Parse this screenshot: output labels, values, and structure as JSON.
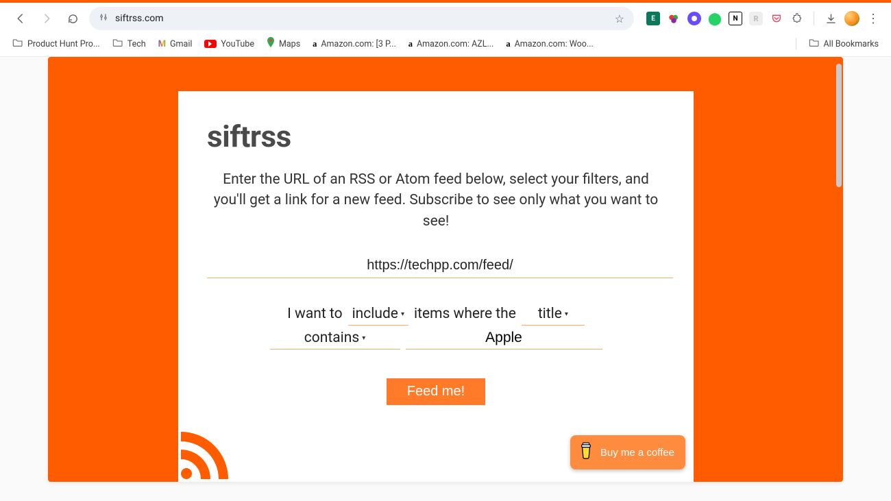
{
  "browser": {
    "url": "siftrss.com",
    "bookmarks": [
      {
        "label": "Product Hunt Pro...",
        "icon": "folder"
      },
      {
        "label": "Tech",
        "icon": "folder"
      },
      {
        "label": "Gmail",
        "icon": "gmail"
      },
      {
        "label": "YouTube",
        "icon": "youtube"
      },
      {
        "label": "Maps",
        "icon": "maps"
      },
      {
        "label": "Amazon.com: [3 P...",
        "icon": "amazon"
      },
      {
        "label": "Amazon.com: AZL...",
        "icon": "amazon"
      },
      {
        "label": "Amazon.com: Woo...",
        "icon": "amazon"
      }
    ],
    "all_bookmarks_label": "All Bookmarks"
  },
  "app": {
    "logo": "siftrss",
    "intro": "Enter the URL of an RSS or Atom feed below, select your filters, and you'll get a link for a new feed. Subscribe to see only what you want to see!",
    "feed_url_value": "https://techpp.com/feed/",
    "filter": {
      "prefix": "I want to",
      "mode": "include",
      "middle": "items where the",
      "field": "title",
      "matcher": "contains",
      "term": "Apple"
    },
    "submit_label": "Feed me!",
    "coffee_label": "Buy me a coffee"
  },
  "colors": {
    "brand_orange": "#ff5c00",
    "button_orange": "#ff7b29",
    "coffee_orange": "#ff8b3e"
  }
}
